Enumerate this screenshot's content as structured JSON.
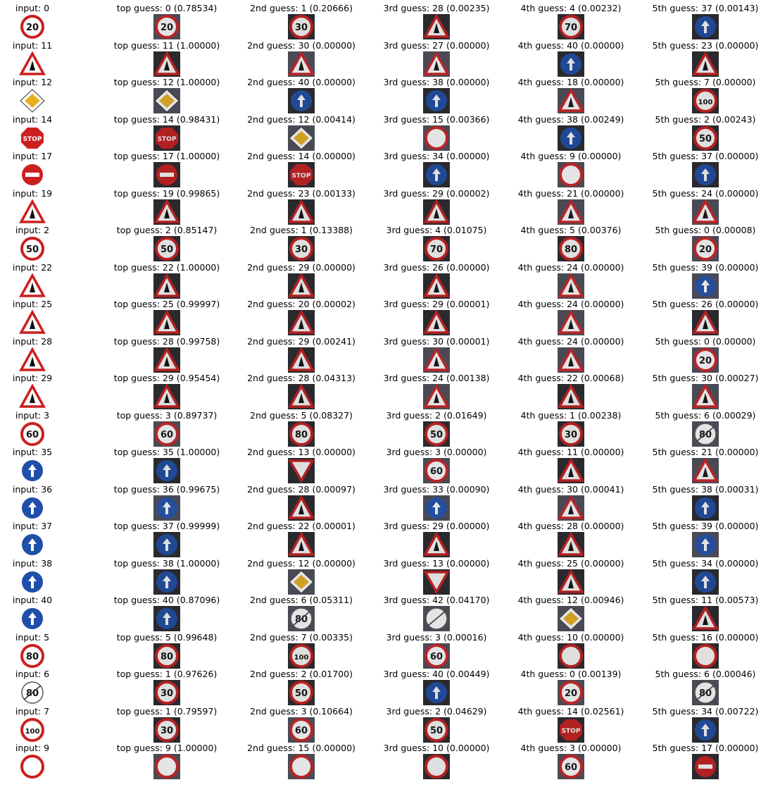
{
  "chart_data": {
    "type": "table",
    "columns": [
      "input",
      "top guess",
      "2nd guess",
      "3rd guess",
      "4th guess",
      "5th guess"
    ],
    "rows": [
      {
        "input": "0",
        "guesses": [
          {
            "cls": "0",
            "p": "0.78534"
          },
          {
            "cls": "1",
            "p": "0.20666"
          },
          {
            "cls": "28",
            "p": "0.00235"
          },
          {
            "cls": "4",
            "p": "0.00232"
          },
          {
            "cls": "37",
            "p": "0.00143"
          }
        ]
      },
      {
        "input": "11",
        "guesses": [
          {
            "cls": "11",
            "p": "1.00000"
          },
          {
            "cls": "30",
            "p": "0.00000"
          },
          {
            "cls": "27",
            "p": "0.00000"
          },
          {
            "cls": "40",
            "p": "0.00000"
          },
          {
            "cls": "23",
            "p": "0.00000"
          }
        ]
      },
      {
        "input": "12",
        "guesses": [
          {
            "cls": "12",
            "p": "1.00000"
          },
          {
            "cls": "40",
            "p": "0.00000"
          },
          {
            "cls": "38",
            "p": "0.00000"
          },
          {
            "cls": "18",
            "p": "0.00000"
          },
          {
            "cls": "7",
            "p": "0.00000"
          }
        ]
      },
      {
        "input": "14",
        "guesses": [
          {
            "cls": "14",
            "p": "0.98431"
          },
          {
            "cls": "12",
            "p": "0.00414"
          },
          {
            "cls": "15",
            "p": "0.00366"
          },
          {
            "cls": "38",
            "p": "0.00249"
          },
          {
            "cls": "2",
            "p": "0.00243"
          }
        ]
      },
      {
        "input": "17",
        "guesses": [
          {
            "cls": "17",
            "p": "1.00000"
          },
          {
            "cls": "14",
            "p": "0.00000"
          },
          {
            "cls": "34",
            "p": "0.00000"
          },
          {
            "cls": "9",
            "p": "0.00000"
          },
          {
            "cls": "37",
            "p": "0.00000"
          }
        ]
      },
      {
        "input": "19",
        "guesses": [
          {
            "cls": "19",
            "p": "0.99865"
          },
          {
            "cls": "23",
            "p": "0.00133"
          },
          {
            "cls": "29",
            "p": "0.00002"
          },
          {
            "cls": "21",
            "p": "0.00000"
          },
          {
            "cls": "24",
            "p": "0.00000"
          }
        ]
      },
      {
        "input": "2",
        "guesses": [
          {
            "cls": "2",
            "p": "0.85147"
          },
          {
            "cls": "1",
            "p": "0.13388"
          },
          {
            "cls": "4",
            "p": "0.01075"
          },
          {
            "cls": "5",
            "p": "0.00376"
          },
          {
            "cls": "0",
            "p": "0.00008"
          }
        ]
      },
      {
        "input": "22",
        "guesses": [
          {
            "cls": "22",
            "p": "1.00000"
          },
          {
            "cls": "29",
            "p": "0.00000"
          },
          {
            "cls": "26",
            "p": "0.00000"
          },
          {
            "cls": "24",
            "p": "0.00000"
          },
          {
            "cls": "39",
            "p": "0.00000"
          }
        ]
      },
      {
        "input": "25",
        "guesses": [
          {
            "cls": "25",
            "p": "0.99997"
          },
          {
            "cls": "20",
            "p": "0.00002"
          },
          {
            "cls": "29",
            "p": "0.00001"
          },
          {
            "cls": "24",
            "p": "0.00000"
          },
          {
            "cls": "26",
            "p": "0.00000"
          }
        ]
      },
      {
        "input": "28",
        "guesses": [
          {
            "cls": "28",
            "p": "0.99758"
          },
          {
            "cls": "29",
            "p": "0.00241"
          },
          {
            "cls": "30",
            "p": "0.00001"
          },
          {
            "cls": "24",
            "p": "0.00000"
          },
          {
            "cls": "0",
            "p": "0.00000"
          }
        ]
      },
      {
        "input": "29",
        "guesses": [
          {
            "cls": "29",
            "p": "0.95454"
          },
          {
            "cls": "28",
            "p": "0.04313"
          },
          {
            "cls": "24",
            "p": "0.00138"
          },
          {
            "cls": "22",
            "p": "0.00068"
          },
          {
            "cls": "30",
            "p": "0.00027"
          }
        ]
      },
      {
        "input": "3",
        "guesses": [
          {
            "cls": "3",
            "p": "0.89737"
          },
          {
            "cls": "5",
            "p": "0.08327"
          },
          {
            "cls": "2",
            "p": "0.01649"
          },
          {
            "cls": "1",
            "p": "0.00238"
          },
          {
            "cls": "6",
            "p": "0.00029"
          }
        ]
      },
      {
        "input": "35",
        "guesses": [
          {
            "cls": "35",
            "p": "1.00000"
          },
          {
            "cls": "13",
            "p": "0.00000"
          },
          {
            "cls": "3",
            "p": "0.00000"
          },
          {
            "cls": "11",
            "p": "0.00000"
          },
          {
            "cls": "21",
            "p": "0.00000"
          }
        ]
      },
      {
        "input": "36",
        "guesses": [
          {
            "cls": "36",
            "p": "0.99675"
          },
          {
            "cls": "28",
            "p": "0.00097"
          },
          {
            "cls": "33",
            "p": "0.00090"
          },
          {
            "cls": "30",
            "p": "0.00041"
          },
          {
            "cls": "38",
            "p": "0.00031"
          }
        ]
      },
      {
        "input": "37",
        "guesses": [
          {
            "cls": "37",
            "p": "0.99999"
          },
          {
            "cls": "22",
            "p": "0.00001"
          },
          {
            "cls": "29",
            "p": "0.00000"
          },
          {
            "cls": "28",
            "p": "0.00000"
          },
          {
            "cls": "39",
            "p": "0.00000"
          }
        ]
      },
      {
        "input": "38",
        "guesses": [
          {
            "cls": "38",
            "p": "1.00000"
          },
          {
            "cls": "12",
            "p": "0.00000"
          },
          {
            "cls": "13",
            "p": "0.00000"
          },
          {
            "cls": "25",
            "p": "0.00000"
          },
          {
            "cls": "34",
            "p": "0.00000"
          }
        ]
      },
      {
        "input": "40",
        "guesses": [
          {
            "cls": "40",
            "p": "0.87096"
          },
          {
            "cls": "6",
            "p": "0.05311"
          },
          {
            "cls": "42",
            "p": "0.04170"
          },
          {
            "cls": "12",
            "p": "0.00946"
          },
          {
            "cls": "11",
            "p": "0.00573"
          }
        ]
      },
      {
        "input": "5",
        "guesses": [
          {
            "cls": "5",
            "p": "0.99648"
          },
          {
            "cls": "7",
            "p": "0.00335"
          },
          {
            "cls": "3",
            "p": "0.00016"
          },
          {
            "cls": "10",
            "p": "0.00000"
          },
          {
            "cls": "16",
            "p": "0.00000"
          }
        ]
      },
      {
        "input": "6",
        "guesses": [
          {
            "cls": "1",
            "p": "0.97626"
          },
          {
            "cls": "2",
            "p": "0.01700"
          },
          {
            "cls": "40",
            "p": "0.00449"
          },
          {
            "cls": "0",
            "p": "0.00139"
          },
          {
            "cls": "6",
            "p": "0.00046"
          }
        ]
      },
      {
        "input": "7",
        "guesses": [
          {
            "cls": "1",
            "p": "0.79597"
          },
          {
            "cls": "3",
            "p": "0.10664"
          },
          {
            "cls": "2",
            "p": "0.04629"
          },
          {
            "cls": "14",
            "p": "0.02561"
          },
          {
            "cls": "34",
            "p": "0.00722"
          }
        ]
      },
      {
        "input": "9",
        "guesses": [
          {
            "cls": "9",
            "p": "1.00000"
          },
          {
            "cls": "15",
            "p": "0.00000"
          },
          {
            "cls": "10",
            "p": "0.00000"
          },
          {
            "cls": "3",
            "p": "0.00000"
          },
          {
            "cls": "17",
            "p": "0.00000"
          }
        ]
      }
    ]
  },
  "labels": {
    "input": "input",
    "ranks": [
      "top guess",
      "2nd guess",
      "3rd guess",
      "4th guess",
      "5th guess"
    ]
  },
  "colors": {
    "background": "#ffffff",
    "text": "#000000",
    "sign_red": "#cc1f1f",
    "sign_blue": "#1f4fa8",
    "sign_white": "#ffffff",
    "thumb_dark": "#2a2a2e",
    "thumb_mid": "#4a4a55"
  }
}
